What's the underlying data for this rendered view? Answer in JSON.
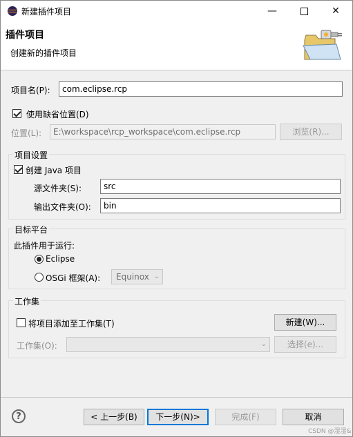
{
  "window": {
    "title": "新建插件项目",
    "app_icon": "eclipse-icon",
    "controls": {
      "minimize": "—",
      "close": "✕"
    }
  },
  "banner": {
    "title": "插件项目",
    "description": "创建新的插件项目",
    "art_icon": "plugin-folder-icon"
  },
  "form": {
    "project_name_label": "项目名(P):",
    "project_name_value": "com.eclipse.rcp",
    "use_default_location_label": "使用缺省位置(D)",
    "use_default_location_checked": true,
    "location_label": "位置(L):",
    "location_value": "E:\\workspace\\rcp_workspace\\com.eclipse.rcp",
    "browse_label": "浏览(R)..."
  },
  "project_settings": {
    "group_title": "项目设置",
    "create_java_label": "创建 Java 项目",
    "create_java_checked": true,
    "source_folder_label": "源文件夹(S):",
    "source_folder_value": "src",
    "output_folder_label": "输出文件夹(O):",
    "output_folder_value": "bin"
  },
  "target_platform": {
    "group_title": "目标平台",
    "run_with_label": "此插件用于运行:",
    "eclipse_label": "Eclipse",
    "eclipse_selected": true,
    "osgi_label": "OSGi 框架(A):",
    "osgi_selected": false,
    "osgi_framework_value": "Equinox"
  },
  "working_set": {
    "group_title": "工作集",
    "add_label": "将项目添加至工作集(T)",
    "add_checked": false,
    "new_button": "新建(W)...",
    "working_set_label": "工作集(O):",
    "working_set_value": "",
    "select_button": "选择(e)..."
  },
  "footer": {
    "help_glyph": "?",
    "back_button": "< 上一步(B)",
    "next_button": "下一步(N)>",
    "finish_button": "完成(F)",
    "cancel_button": "取消"
  },
  "watermark": "CSDN @湿湿&"
}
